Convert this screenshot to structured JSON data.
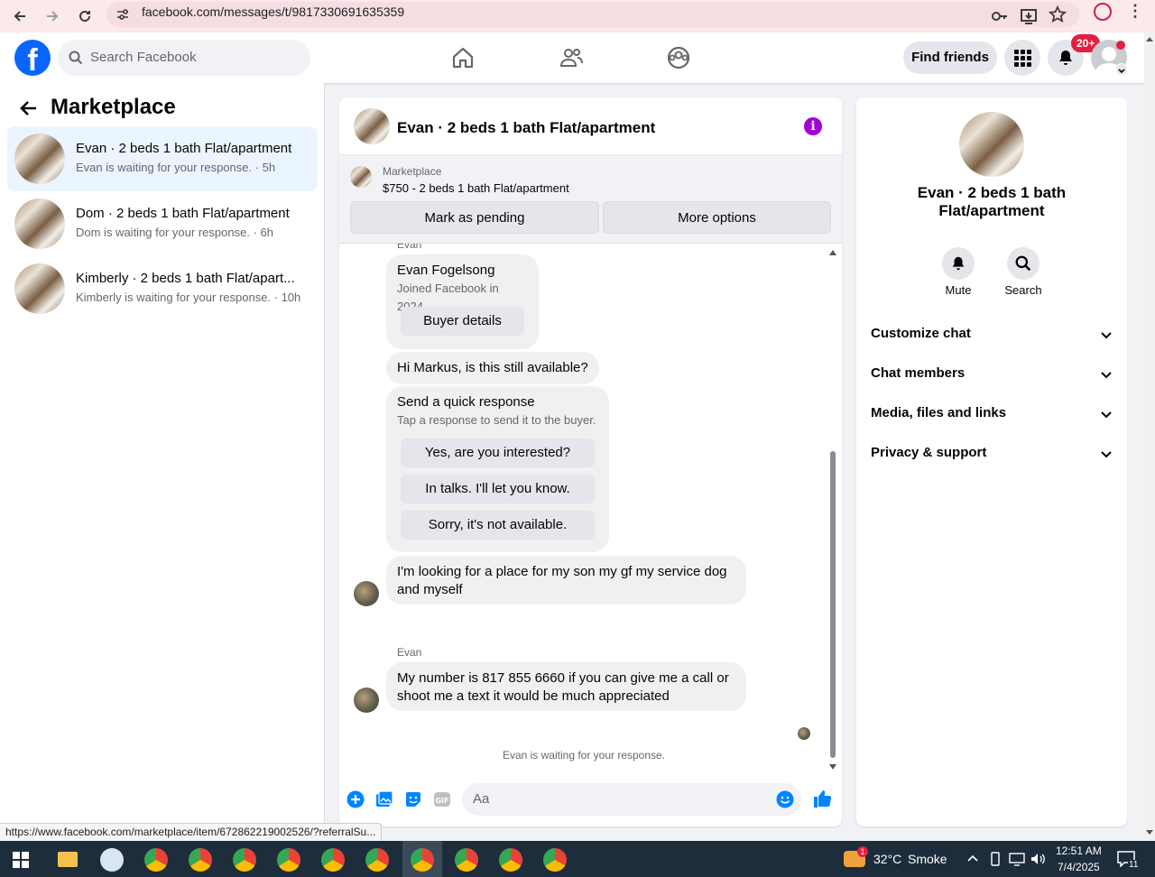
{
  "browser": {
    "url": "facebook.com/messages/t/9817330691635359"
  },
  "header": {
    "search_placeholder": "Search Facebook",
    "find_friends": "Find friends",
    "notif_badge": "20+"
  },
  "left": {
    "title": "Marketplace",
    "conversations": [
      {
        "name": "Evan · 2 beds 1 bath Flat/apartment",
        "sub": "Evan is waiting for your response. · 5h"
      },
      {
        "name": "Dom · 2 beds 1 bath Flat/apartment",
        "sub": "Dom is waiting for your response. · 6h"
      },
      {
        "name": "Kimberly · 2 beds 1 bath Flat/apart...",
        "sub": "Kimberly is waiting for your response. · 10h"
      }
    ]
  },
  "chat": {
    "title": "Evan · 2 beds 1 bath Flat/apartment",
    "marketplace_label": "Marketplace",
    "listing": "$750 - 2 beds 1 bath Flat/apartment",
    "mark_pending": "Mark as pending",
    "more_options": "More options",
    "sender_top": "Evan",
    "buyer_name": "Evan Fogelsong",
    "buyer_joined": "Joined Facebook in 2024",
    "buyer_details": "Buyer details",
    "msg1": "Hi Markus, is this still available?",
    "quick_title": "Send a quick response",
    "quick_sub": "Tap a response to send it to the buyer.",
    "quick_replies": [
      "Yes, are you interested?",
      "In talks. I'll let you know.",
      "Sorry, it's not available."
    ],
    "msg2": "I'm looking for a place for my son my gf my service dog and myself",
    "sender2": "Evan",
    "msg3": "My number is 817 855 6660 if you can give me a call or shoot me a text it would be much appreciated",
    "waiting": "Evan is waiting for your response.",
    "composer_placeholder": "Aa"
  },
  "right": {
    "title": "Evan · 2 beds 1 bath Flat/apartment",
    "mute": "Mute",
    "search": "Search",
    "sections": [
      "Customize chat",
      "Chat members",
      "Media, files and links",
      "Privacy & support"
    ]
  },
  "status_url": "https://www.facebook.com/marketplace/item/672862219002526/?referralSu...",
  "taskbar": {
    "weather_temp": "32°C",
    "weather_desc": "Smoke",
    "time": "12:51 AM",
    "date": "7/4/2025",
    "weather_badge": "1",
    "notif_count": "11"
  },
  "colors": {
    "fb_blue": "#0866ff",
    "messenger_blue": "#0084ff",
    "info_purple": "#a200d6",
    "badge_red": "#e41e3f"
  }
}
